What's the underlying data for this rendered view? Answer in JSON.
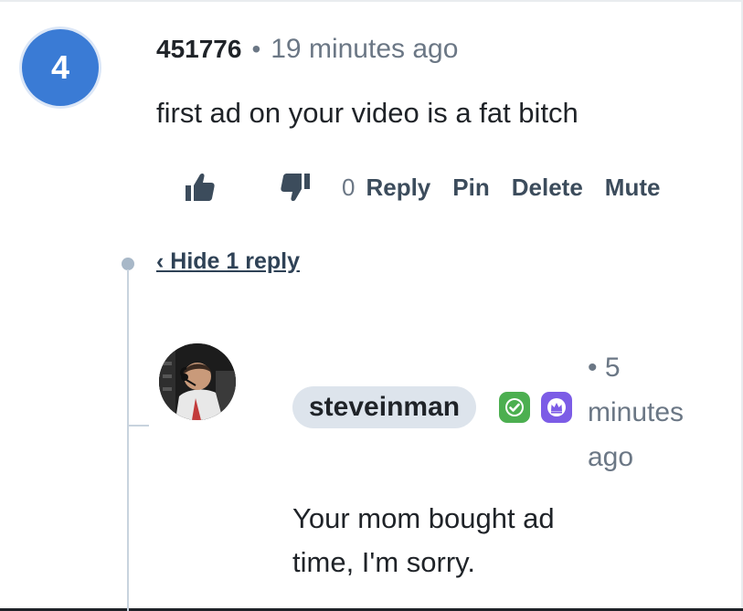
{
  "comment": {
    "rank": "4",
    "username": "451776",
    "separator": "•",
    "time": "19 minutes ago",
    "text": "first ad on your video is a fat bitch",
    "like_icon": "thumbs-up-icon",
    "dislike_icon": "thumbs-down-icon",
    "vote_count": "0",
    "actions": {
      "reply": "Reply",
      "pin": "Pin",
      "delete": "Delete",
      "mute": "Mute"
    }
  },
  "replies_toggle": "‹ Hide 1 reply",
  "reply": {
    "username": "steveinman",
    "badges": [
      "verified-check-icon",
      "crown-icon"
    ],
    "time_line1": "• 5",
    "time_line2": "minutes",
    "time_line3": "ago",
    "text": "Your mom bought ad time, I'm sorry."
  },
  "colors": {
    "rank_badge": "#3a7bd5",
    "verified_badge": "#4caf50",
    "crown_badge": "#7c5ce6",
    "name_pill": "#dde4ec",
    "muted_text": "#6b7785",
    "action_text": "#3c4c5c"
  }
}
